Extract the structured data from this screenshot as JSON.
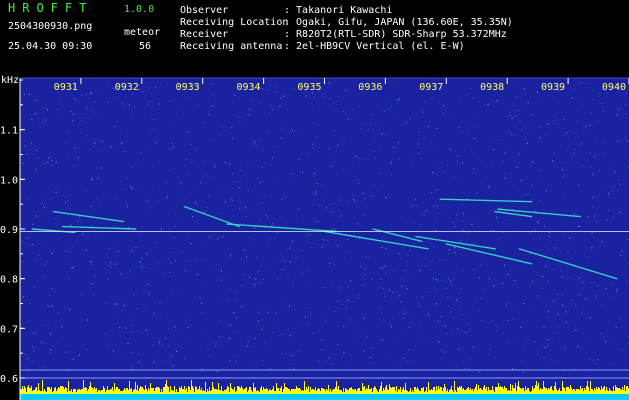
{
  "header": {
    "brand": "HROFFT",
    "version": "1.0.0",
    "filename": "2504300930.png",
    "datetime": "25.04.30 09:30",
    "meteor_label": "meteor",
    "meteor_count": "56",
    "meta": [
      {
        "label": "Observer",
        "value": ": Takanori Kawachi"
      },
      {
        "label": "Receiving Location",
        "value": ": Ogaki, Gifu, JAPAN (136.60E, 35.35N)"
      },
      {
        "label": "Receiver",
        "value": ": R820T2(RTL-SDR) SDR-Sharp 53.372MHz"
      },
      {
        "label": "Receiving antenna",
        "value": ": 2el-HB9CV Vertical (el. E-W)"
      }
    ]
  },
  "colors": {
    "background": "#1a22a0",
    "text_green": "#3cf03c",
    "tick": "#ffffff",
    "time_label": "#ffff66",
    "carrier": "#dde6ff",
    "meteor": "#38e0c8",
    "power_fill": "#ffff00",
    "power_base": "#00ccff"
  },
  "chart_data": {
    "type": "heatmap",
    "ylabel": "kHz",
    "ylim": [
      0.6,
      1.2
    ],
    "y_ticks": [
      "1.1",
      "1.0",
      "0.9",
      "0.8",
      "0.7",
      "0.6"
    ],
    "x_ticks": [
      "0931",
      "0932",
      "0933",
      "0934",
      "0935",
      "0936",
      "0937",
      "0938",
      "0939",
      "0940"
    ],
    "xlim": [
      930,
      940
    ],
    "carrier_khz": 0.895,
    "meteor_traces": [
      {
        "x": [
          930.55,
          931.7
        ],
        "y": [
          0.935,
          0.915
        ]
      },
      {
        "x": [
          930.2,
          930.9
        ],
        "y": [
          0.9,
          0.893
        ]
      },
      {
        "x": [
          932.7,
          933.6
        ],
        "y": [
          0.945,
          0.905
        ]
      },
      {
        "x": [
          933.4,
          935.2
        ],
        "y": [
          0.91,
          0.895
        ]
      },
      {
        "x": [
          935.0,
          936.7
        ],
        "y": [
          0.895,
          0.86
        ]
      },
      {
        "x": [
          935.8,
          936.6
        ],
        "y": [
          0.9,
          0.875
        ]
      },
      {
        "x": [
          936.9,
          938.4
        ],
        "y": [
          0.96,
          0.955
        ]
      },
      {
        "x": [
          936.5,
          937.8
        ],
        "y": [
          0.885,
          0.86
        ]
      },
      {
        "x": [
          937.0,
          938.4
        ],
        "y": [
          0.87,
          0.83
        ]
      },
      {
        "x": [
          937.85,
          939.2
        ],
        "y": [
          0.94,
          0.925
        ]
      },
      {
        "x": [
          937.8,
          938.4
        ],
        "y": [
          0.935,
          0.925
        ]
      },
      {
        "x": [
          938.2,
          939.8
        ],
        "y": [
          0.86,
          0.8
        ]
      },
      {
        "x": [
          930.7,
          931.9
        ],
        "y": [
          0.905,
          0.9
        ]
      }
    ]
  }
}
